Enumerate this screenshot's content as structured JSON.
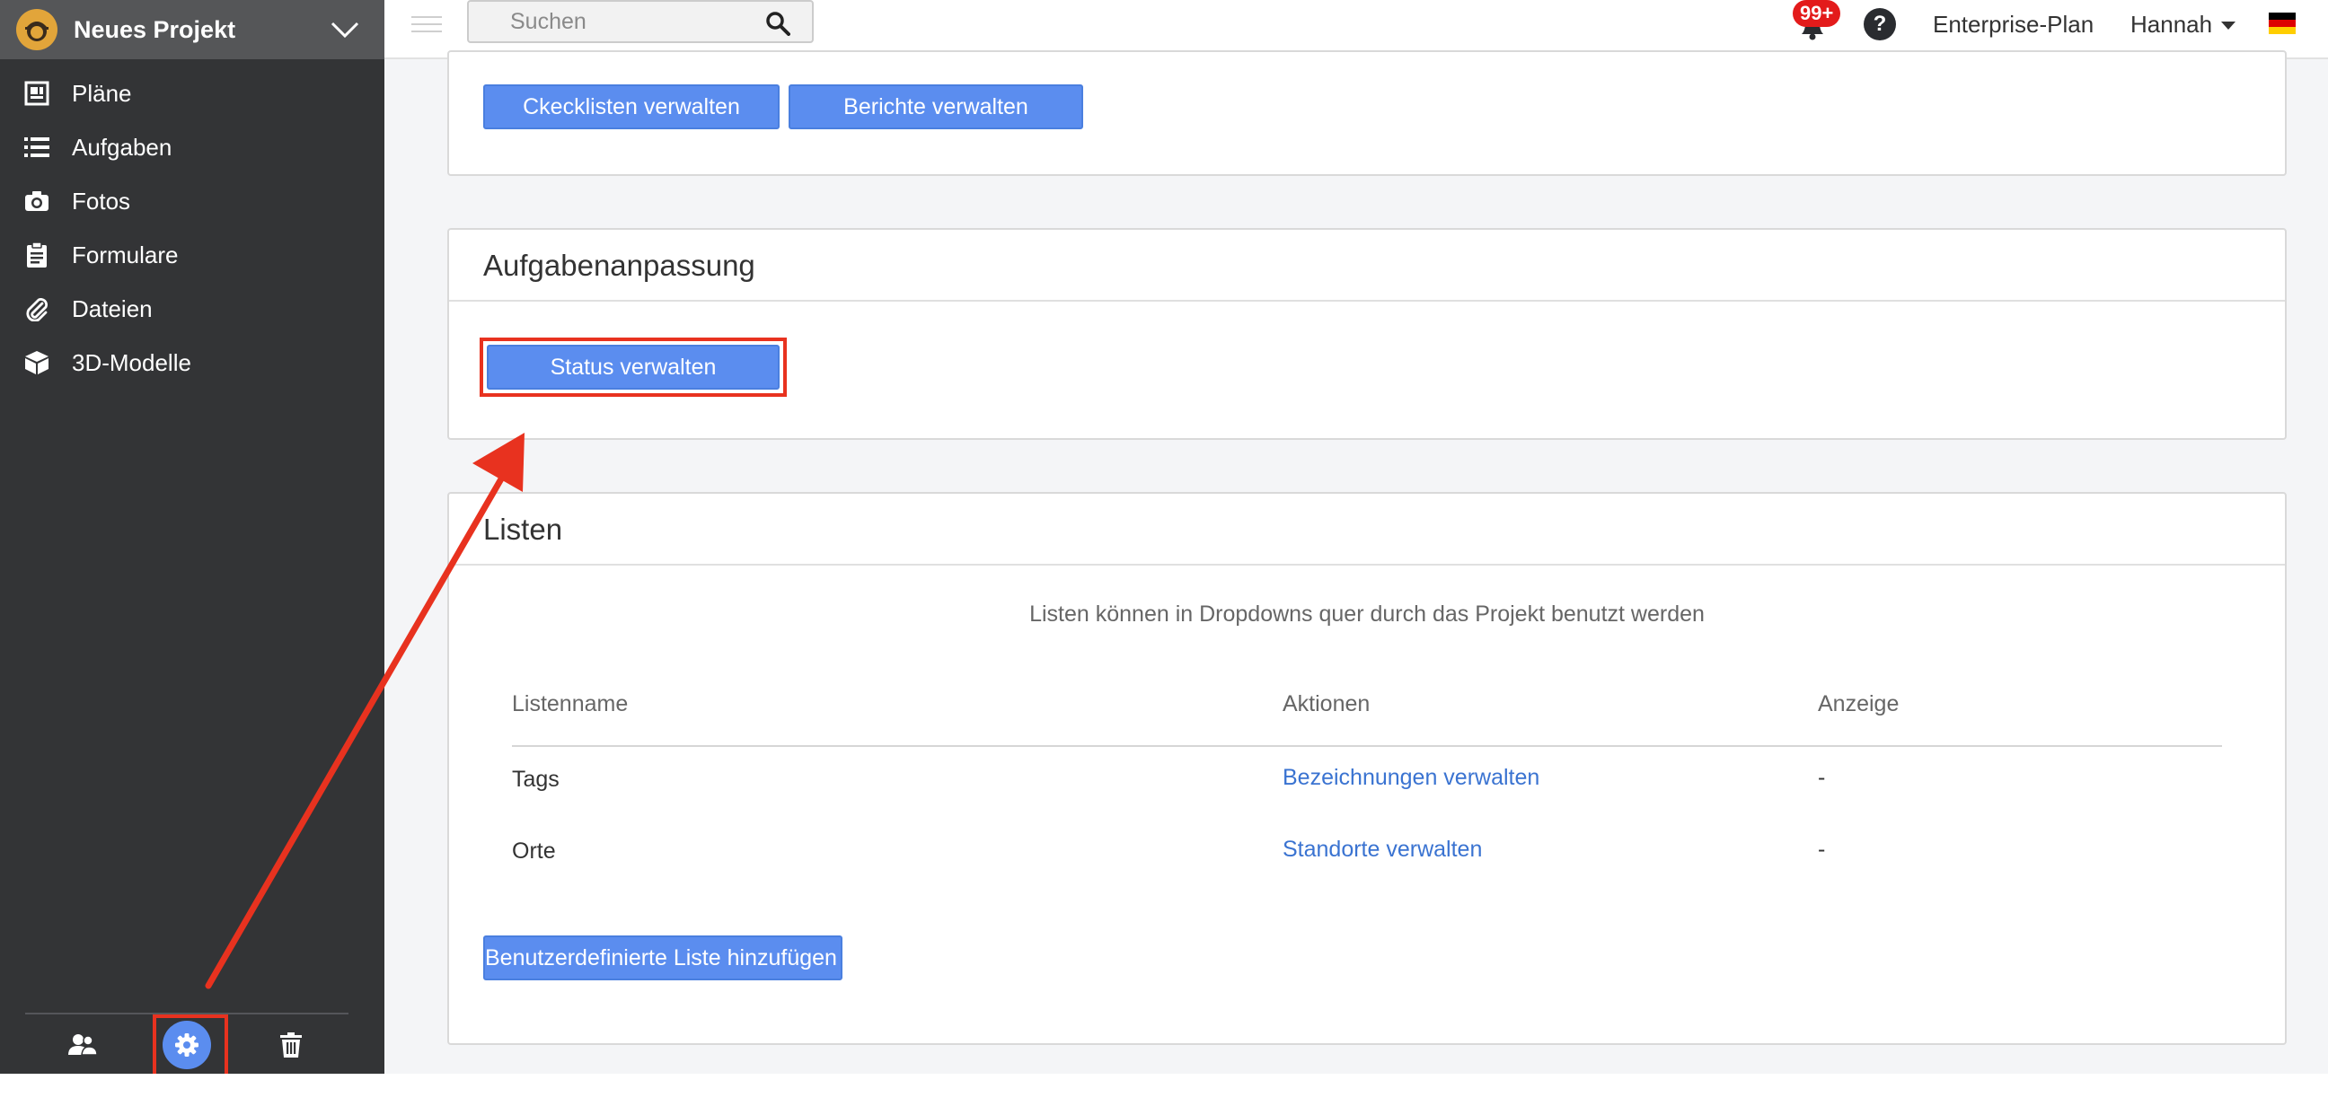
{
  "project": {
    "name": "Neues Projekt"
  },
  "sidebar": {
    "items": [
      {
        "label": "Pläne",
        "icon": "blueprint-icon"
      },
      {
        "label": "Aufgaben",
        "icon": "list-icon"
      },
      {
        "label": "Fotos",
        "icon": "camera-icon"
      },
      {
        "label": "Formulare",
        "icon": "clipboard-icon"
      },
      {
        "label": "Dateien",
        "icon": "paperclip-icon"
      },
      {
        "label": "3D-Modelle",
        "icon": "cube-icon"
      }
    ],
    "bottom": [
      "users-icon",
      "settings-gear-icon",
      "trash-icon"
    ]
  },
  "topbar": {
    "search_placeholder": "Suchen",
    "notification_badge": "99+",
    "help": "?",
    "plan": "Enterprise-Plan",
    "user": "Hannah",
    "language_flag": "de"
  },
  "main": {
    "top_card": {
      "buttons": [
        "Ckecklisten verwalten",
        "Berichte verwalten"
      ]
    },
    "aufgaben_card": {
      "title": "Aufgabenanpassung",
      "button": "Status verwalten"
    },
    "listen_card": {
      "title": "Listen",
      "description": "Listen können in Dropdowns quer durch das Projekt benutzt werden",
      "columns": [
        "Listenname",
        "Aktionen",
        "Anzeige"
      ],
      "rows": [
        {
          "name": "Tags",
          "action": "Bezeichnungen verwalten",
          "display": "-"
        },
        {
          "name": "Orte",
          "action": "Standorte verwalten",
          "display": "-"
        }
      ],
      "add_button": "Benutzerdefinierte Liste hinzufügen"
    }
  },
  "colors": {
    "accent_blue": "#5b8def",
    "highlight_red": "#e8321f",
    "sidebar_bg": "#333436",
    "link_blue": "#3a73d1"
  }
}
